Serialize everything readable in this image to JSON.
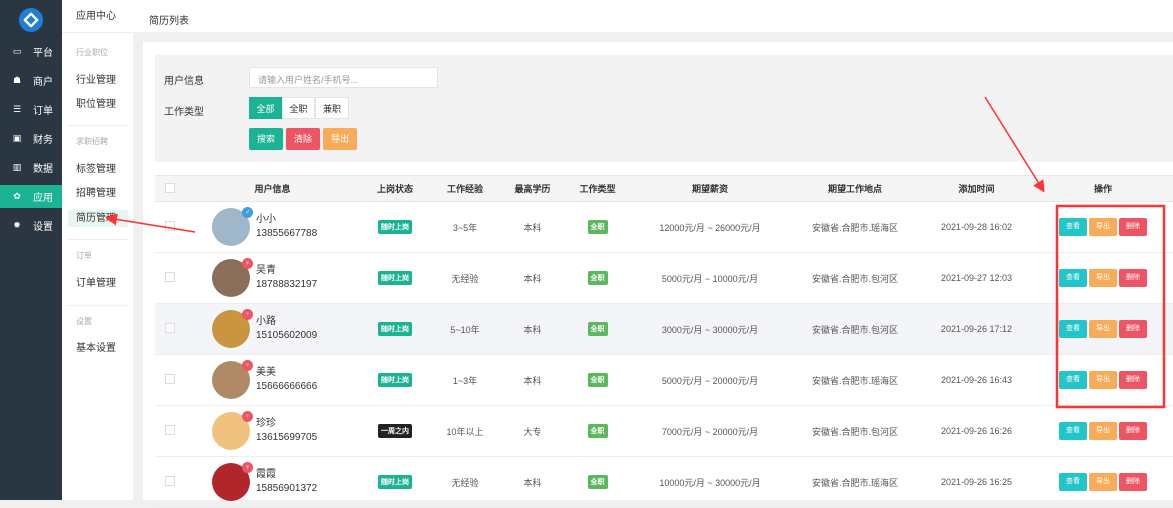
{
  "sidebar": {
    "items": [
      {
        "label": "平台",
        "icon": "monitor-icon"
      },
      {
        "label": "商户",
        "icon": "users-icon"
      },
      {
        "label": "订单",
        "icon": "list-icon"
      },
      {
        "label": "财务",
        "icon": "money-icon"
      },
      {
        "label": "数据",
        "icon": "chart-icon"
      },
      {
        "label": "应用",
        "icon": "apps-icon",
        "active": true
      },
      {
        "label": "设置",
        "icon": "gear-icon"
      }
    ]
  },
  "subnav": {
    "title": "应用中心",
    "groups": [
      {
        "title": "行业职位",
        "items": [
          "行业管理",
          "职位管理"
        ]
      },
      {
        "title": "求职招聘",
        "items": [
          "标签管理",
          "招聘管理",
          "简历管理"
        ]
      },
      {
        "title": "订单",
        "items": [
          "订单管理"
        ]
      },
      {
        "title": "设置",
        "items": [
          "基本设置"
        ]
      }
    ],
    "active": "简历管理"
  },
  "header": {
    "breadcrumb": "简历列表"
  },
  "filter": {
    "user_label": "用户信息",
    "user_placeholder": "请输入用户姓名/手机号...",
    "type_label": "工作类型",
    "types": [
      "全部",
      "全职",
      "兼职"
    ],
    "search": "搜索",
    "clear": "清除",
    "export": "导出"
  },
  "table": {
    "headers": [
      "用户信息",
      "上岗状态",
      "工作经验",
      "最高学历",
      "工作类型",
      "期望薪资",
      "期望工作地点",
      "添加时间",
      "操作"
    ],
    "actions": {
      "view": "查看",
      "export": "导出",
      "delete": "删除"
    },
    "rows": [
      {
        "name": "小小",
        "phone": "13855667788",
        "gender": "♂",
        "status": "随时上岗",
        "exp": "3~5年",
        "edu": "本科",
        "type": "全职",
        "salary": "12000元/月 ~ 26000元/月",
        "loc": "安徽省.合肥市.瑶海区",
        "time": "2021-09-28 16:02",
        "avatar": "#9fb7c9"
      },
      {
        "name": "吴青",
        "phone": "18788832197",
        "gender": "♀",
        "status": "随时上岗",
        "exp": "无经验",
        "edu": "本科",
        "type": "全职",
        "salary": "5000元/月 ~ 10000元/月",
        "loc": "安徽省.合肥市.包河区",
        "time": "2021-09-27 12:03",
        "avatar": "#8a6e5a"
      },
      {
        "name": "小路",
        "phone": "15105602009",
        "gender": "♀",
        "status": "随时上岗",
        "exp": "5~10年",
        "edu": "本科",
        "type": "全职",
        "salary": "3000元/月 ~ 30000元/月",
        "loc": "安徽省.合肥市.包河区",
        "time": "2021-09-26 17:12",
        "avatar": "#c9953f"
      },
      {
        "name": "美美",
        "phone": "15666666666",
        "gender": "♀",
        "status": "随时上岗",
        "exp": "1~3年",
        "edu": "本科",
        "type": "全职",
        "salary": "5000元/月 ~ 20000元/月",
        "loc": "安徽省.合肥市.瑶海区",
        "time": "2021-09-26 16:43",
        "avatar": "#b08a66"
      },
      {
        "name": "珍珍",
        "phone": "13615699705",
        "gender": "♀",
        "status": "一周之内",
        "exp": "10年以上",
        "edu": "大专",
        "type": "全职",
        "salary": "7000元/月 ~ 20000元/月",
        "loc": "安徽省.合肥市.包河区",
        "time": "2021-09-26 16:26",
        "avatar": "#f1c27d"
      },
      {
        "name": "霞霞",
        "phone": "15856901372",
        "gender": "♀",
        "status": "随时上岗",
        "exp": "无经验",
        "edu": "本科",
        "type": "全职",
        "salary": "10000元/月 ~ 30000元/月",
        "loc": "安徽省.合肥市.瑶海区",
        "time": "2021-09-26 16:25",
        "avatar": "#b0262b"
      }
    ]
  },
  "colors": {
    "primary": "#1ab394",
    "danger": "#ed5565",
    "warning": "#f8ac59",
    "info": "#23c6c8",
    "dark": "#2b3643"
  }
}
